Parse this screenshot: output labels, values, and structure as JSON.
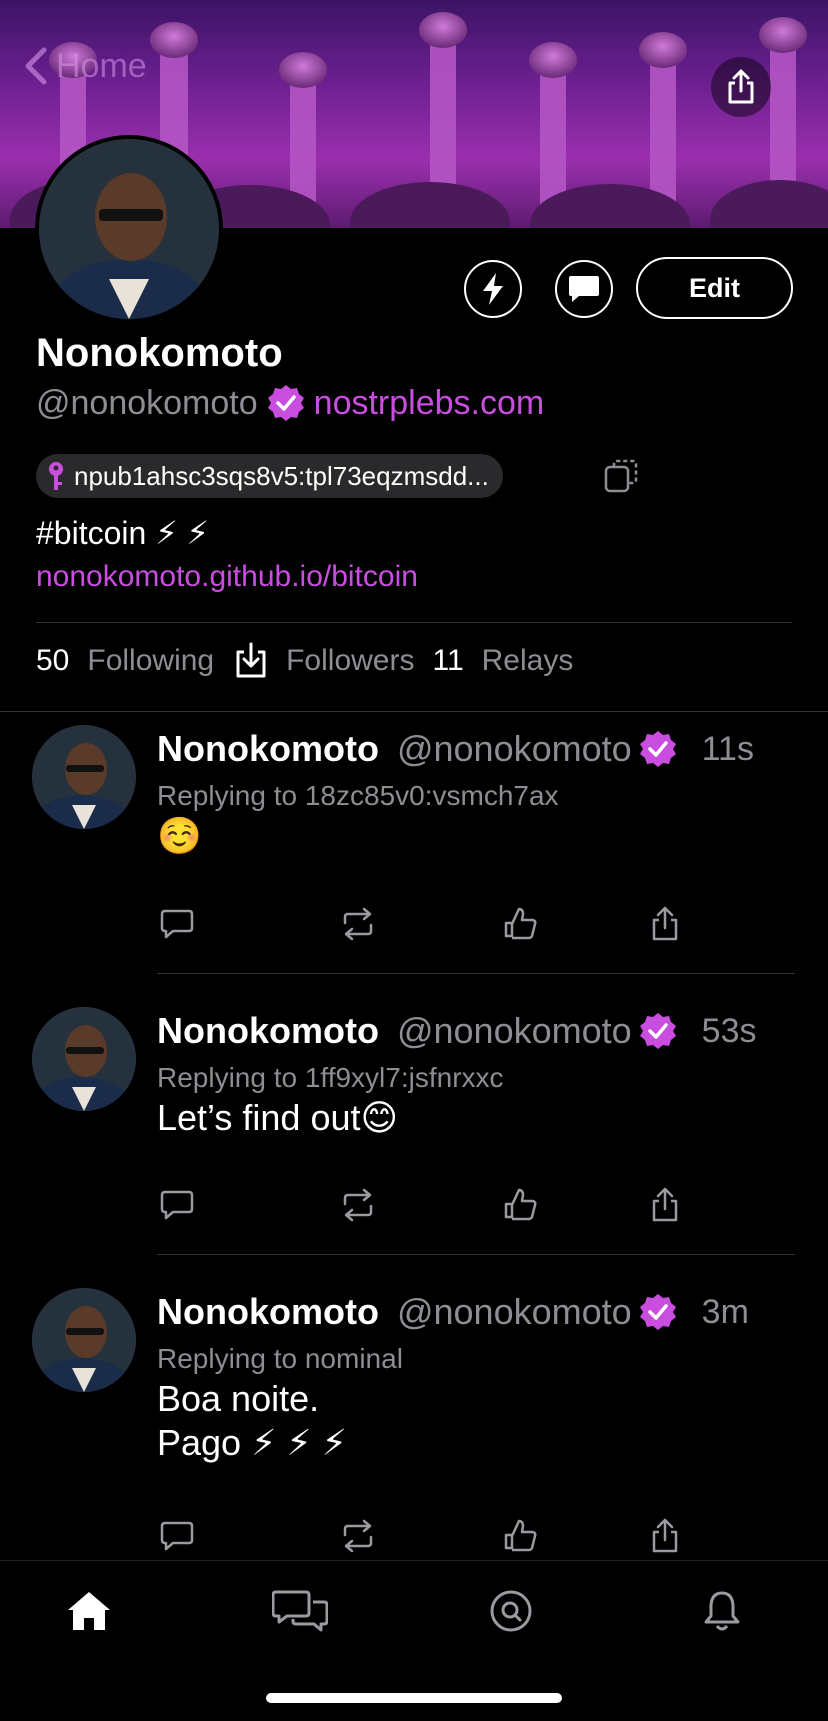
{
  "header": {
    "back_label": "Home",
    "banner_desc": "purple ostriches banner"
  },
  "profile": {
    "display_name": "Nonokomoto",
    "handle": "@nonokomoto",
    "nip05": "nostrplebs.com",
    "npub": "npub1ahsc3sqs8v5:tpl73eqzmsdd...",
    "about": "#bitcoin ⚡ ⚡",
    "website": "nonokomoto.github.io/bitcoin",
    "edit_label": "Edit",
    "accent_color": "#c94ee0"
  },
  "stats": {
    "following_count": "50",
    "following_label": "Following",
    "followers_label": "Followers",
    "relays_count": "11",
    "relays_label": "Relays"
  },
  "posts": [
    {
      "name": "Nonokomoto",
      "handle": "@nonokomoto",
      "time": "11s",
      "reply_to": "Replying to 18zc85v0:vsmch7ax",
      "content": "☺️"
    },
    {
      "name": "Nonokomoto",
      "handle": "@nonokomoto",
      "time": "53s",
      "reply_to": "Replying to 1ff9xyl7:jsfnrxxc",
      "content": "Let’s find out😊"
    },
    {
      "name": "Nonokomoto",
      "handle": "@nonokomoto",
      "time": "3m",
      "reply_to": "Replying to nominal",
      "content": "Boa noite.\nPago ⚡ ⚡ ⚡"
    }
  ],
  "tabs": [
    {
      "icon": "home-icon",
      "active": true
    },
    {
      "icon": "chat-bubbles-icon",
      "active": false
    },
    {
      "icon": "search-icon",
      "active": false
    },
    {
      "icon": "bell-icon",
      "active": false
    }
  ]
}
